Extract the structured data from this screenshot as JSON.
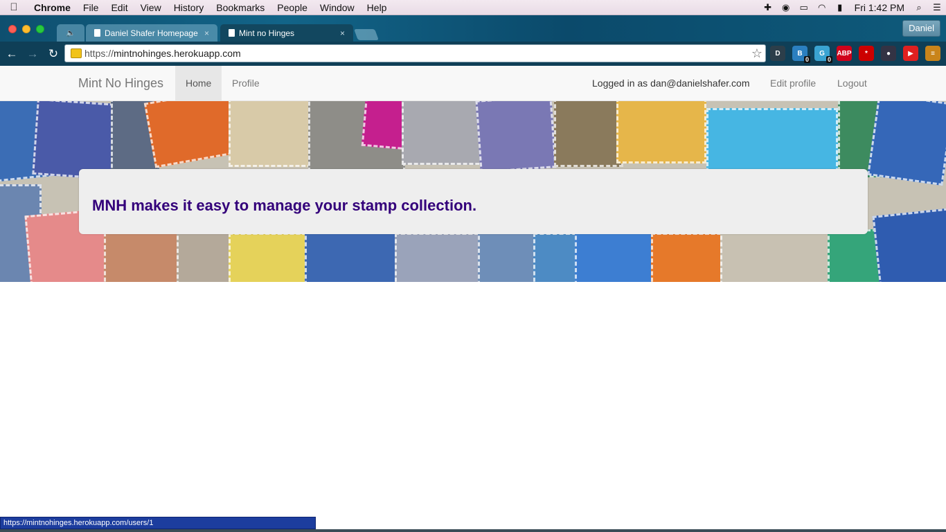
{
  "menubar": {
    "app_name": "Chrome",
    "items": [
      "File",
      "Edit",
      "View",
      "History",
      "Bookmarks",
      "People",
      "Window",
      "Help"
    ],
    "clock": "Fri 1:42 PM"
  },
  "browser": {
    "tabs": [
      {
        "label": "Daniel Shafer Homepage"
      },
      {
        "label": "Mint no Hinges"
      }
    ],
    "profile_name": "Daniel",
    "url_prefix": "https://",
    "url_host": "mintnohinges.herokuapp.com",
    "extensions": [
      {
        "name": "dl-icon",
        "color": "#2c3e4a",
        "text": "D",
        "count": ""
      },
      {
        "name": "shield-ext-icon",
        "color": "#2b7fc0",
        "text": "B",
        "count": "0"
      },
      {
        "name": "ghostery-icon",
        "color": "#3aa3d1",
        "text": "G",
        "count": "0"
      },
      {
        "name": "adblock-icon",
        "color": "#d0021b",
        "text": "ABP",
        "count": ""
      },
      {
        "name": "lastpass-icon",
        "color": "#cc0000",
        "text": "*",
        "count": ""
      },
      {
        "name": "dark-ext-icon",
        "color": "#334",
        "text": "●",
        "count": ""
      },
      {
        "name": "youtube-ext-icon",
        "color": "#e02020",
        "text": "▶",
        "count": ""
      },
      {
        "name": "menu-icon",
        "color": "#c9841a",
        "text": "≡",
        "count": ""
      }
    ]
  },
  "site": {
    "brand": "Mint No Hinges",
    "nav": {
      "home": "Home",
      "profile": "Profile",
      "logged_in": "Logged in as dan@danielshafer.com",
      "edit_profile": "Edit profile",
      "logout": "Logout"
    },
    "jumbotron_text": "MNH makes it easy to manage your stamp collection."
  },
  "status_bar": {
    "url": "https://mintnohinges.herokuapp.com/users/1"
  }
}
